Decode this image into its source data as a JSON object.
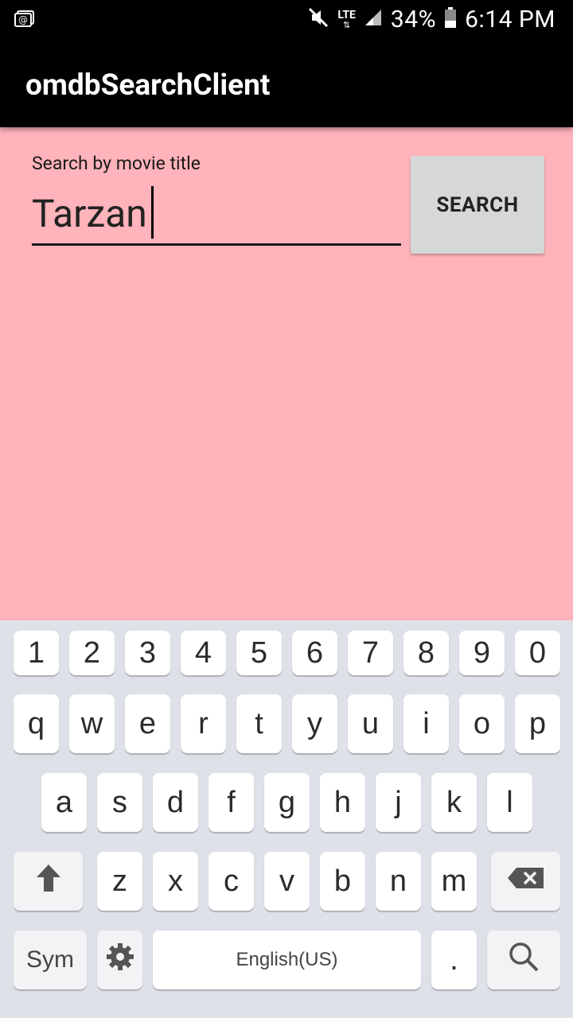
{
  "status_bar": {
    "network": "LTE",
    "battery": "34%",
    "time": "6:14 PM"
  },
  "app": {
    "title": "omdbSearchClient"
  },
  "search": {
    "label": "Search by movie title",
    "value": "Tarzan",
    "button_label": "SEARCH"
  },
  "keyboard": {
    "numbers": [
      "1",
      "2",
      "3",
      "4",
      "5",
      "6",
      "7",
      "8",
      "9",
      "0"
    ],
    "row1": [
      "q",
      "w",
      "e",
      "r",
      "t",
      "y",
      "u",
      "i",
      "o",
      "p"
    ],
    "row2": [
      "a",
      "s",
      "d",
      "f",
      "g",
      "h",
      "j",
      "k",
      "l"
    ],
    "row3": [
      "z",
      "x",
      "c",
      "v",
      "b",
      "n",
      "m"
    ],
    "sym_label": "Sym",
    "space_label": "English(US)",
    "period_label": "."
  },
  "colors": {
    "background": "#ffb3ba",
    "appbar": "#000000",
    "button": "#d6d7d7",
    "keyboard_bg": "#dfe1e8"
  }
}
